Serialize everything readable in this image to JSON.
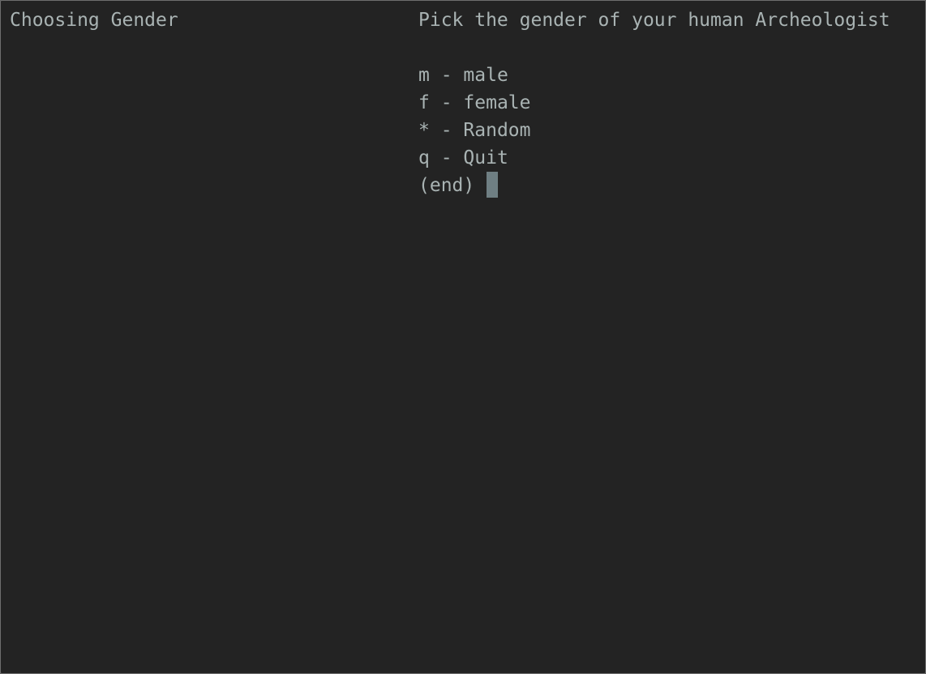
{
  "header": {
    "left_title": "Choosing Gender",
    "prompt": "Pick the gender of your human Archeologist"
  },
  "menu": {
    "options": [
      {
        "key": "m",
        "separator": " - ",
        "label": "male"
      },
      {
        "key": "f",
        "separator": " - ",
        "label": "female"
      },
      {
        "key": "*",
        "separator": " - ",
        "label": "Random"
      },
      {
        "key": "q",
        "separator": " - ",
        "label": "Quit"
      }
    ],
    "end_marker": "(end) "
  },
  "colors": {
    "background": "#232323",
    "text": "#a9b3b3",
    "cursor": "#6f7f83"
  }
}
